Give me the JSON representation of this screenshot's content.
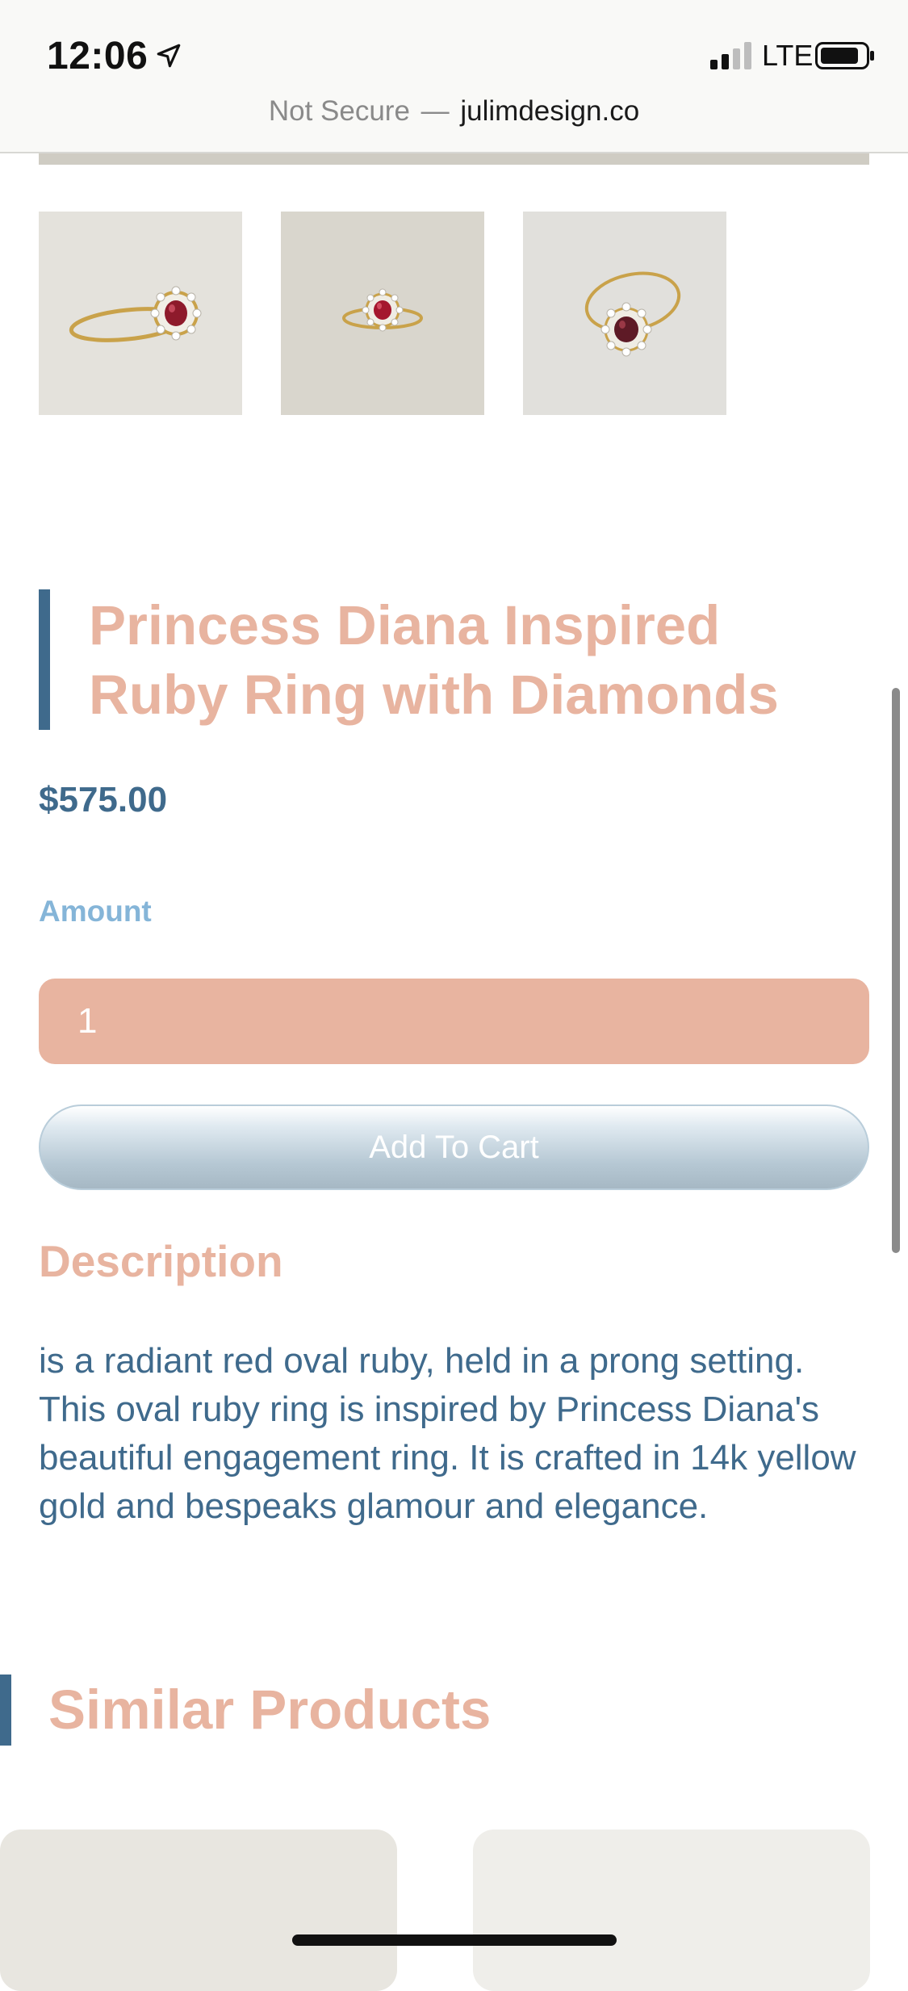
{
  "status_bar": {
    "time": "12:06",
    "network": "LTE",
    "location_icon": "location-arrow-icon",
    "signal_icon": "cellular-signal-icon",
    "battery_icon": "battery-icon"
  },
  "url_bar": {
    "security": "Not Secure",
    "separator": "—",
    "domain": "julimdesign.co"
  },
  "gallery": {
    "thumbnails": [
      {
        "alt": "ruby ring side view",
        "icon": "ring-image"
      },
      {
        "alt": "ruby ring front view",
        "icon": "ring-image"
      },
      {
        "alt": "ruby ring angled view",
        "icon": "ring-image"
      }
    ]
  },
  "product": {
    "title": "Princess Diana Inspired Ruby Ring with Diamonds",
    "price": "$575.00",
    "amount_label": "Amount",
    "quantity": "1",
    "add_to_cart_label": "Add To Cart",
    "description_heading": "Description",
    "description": "is a radiant red oval ruby, held in a prong setting. This oval ruby ring is inspired by Princess Diana's beautiful engagement ring. It is crafted in 14k yellow gold and bespeaks glamour and elegance."
  },
  "similar": {
    "heading": "Similar Products"
  },
  "colors": {
    "accent_peach": "#e8b4a0",
    "accent_blue": "#3f6a8c",
    "label_light_blue": "#85b5d8"
  }
}
